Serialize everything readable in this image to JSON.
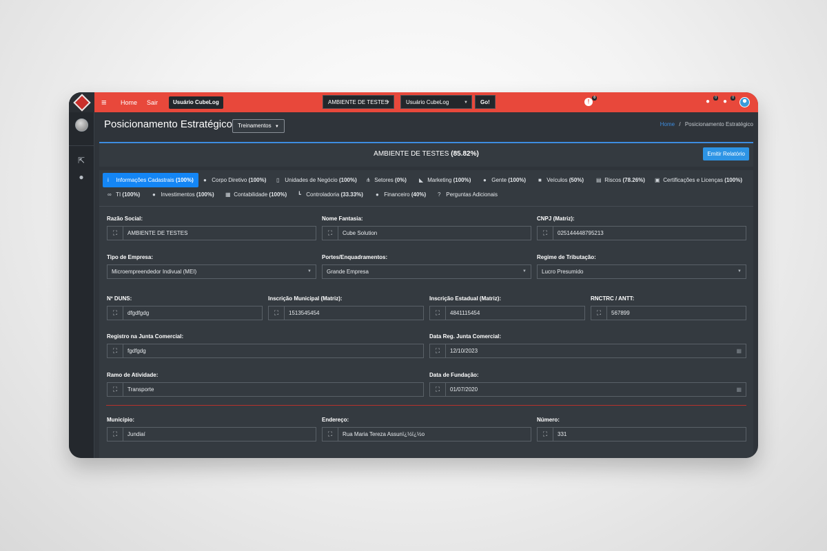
{
  "topbar": {
    "home": "Home",
    "sair": "Sair",
    "user_chip": "Usuário CubeLog",
    "env_select": "AMBIENTE DE TESTES",
    "user_select": "Usuário CubeLog",
    "go": "Go!",
    "notif_count": "0",
    "users_count_1": "0",
    "users_count_2": "0"
  },
  "page": {
    "title": "Posicionamento Estratégico",
    "treinamentos": "Treinamentos",
    "breadcrumb_home": "Home",
    "breadcrumb_sep": "/",
    "breadcrumb_current": "Posicionamento Estratégico"
  },
  "env": {
    "title_prefix": "AMBIENTE DE TESTES",
    "percent": "(85.82%)",
    "emitir": "Emitir Relatório"
  },
  "tabs": [
    {
      "label": "Informações Cadastrais",
      "pct": "(100%)",
      "icon": "info-icon",
      "glyph": "i"
    },
    {
      "label": "Corpo Diretivo",
      "pct": "(100%)",
      "icon": "user-icon",
      "glyph": "●"
    },
    {
      "label": "Unidades de Negócio",
      "pct": "(100%)",
      "icon": "building-icon",
      "glyph": "▯"
    },
    {
      "label": "Setores",
      "pct": "(0%)",
      "icon": "sitemap-icon",
      "glyph": "⋔"
    },
    {
      "label": "Marketing",
      "pct": "(100%)",
      "icon": "bullhorn-icon",
      "glyph": "◣"
    },
    {
      "label": "Gente",
      "pct": "(100%)",
      "icon": "users-icon",
      "glyph": "●"
    },
    {
      "label": "Veículos",
      "pct": "(50%)",
      "icon": "truck-icon",
      "glyph": "■"
    },
    {
      "label": "Riscos",
      "pct": "(78.26%)",
      "icon": "clipboard-icon",
      "glyph": "▤"
    },
    {
      "label": "Certificações e Licenças",
      "pct": "(100%)",
      "icon": "certificate-icon",
      "glyph": "▣"
    },
    {
      "label": "TI",
      "pct": "(100%)",
      "icon": "glasses-icon",
      "glyph": "∞"
    },
    {
      "label": "Investimentos",
      "pct": "(100%)",
      "icon": "coins-icon",
      "glyph": "●"
    },
    {
      "label": "Contabilidade",
      "pct": "(100%)",
      "icon": "calculator-icon",
      "glyph": "▦"
    },
    {
      "label": "Controladoria",
      "pct": "(33.33%)",
      "icon": "chart-icon",
      "glyph": "┗"
    },
    {
      "label": "Financeiro",
      "pct": "(40%)",
      "icon": "money-icon",
      "glyph": "●"
    },
    {
      "label": "Perguntas Adicionais",
      "pct": "",
      "icon": "question-icon",
      "glyph": "?"
    }
  ],
  "form": {
    "razao_social": {
      "label": "Razão Social:",
      "value": "AMBIENTE DE TESTES"
    },
    "nome_fantasia": {
      "label": "Nome Fantasia:",
      "value": "Cube Solution"
    },
    "cnpj": {
      "label": "CNPJ (Matriz):",
      "value": "025144448795213"
    },
    "tipo_empresa": {
      "label": "Tipo de Empresa:",
      "value": "Microempreendedor Indivual (MEI)"
    },
    "portes": {
      "label": "Portes/Enquadramentos:",
      "value": "Grande Empresa"
    },
    "regime": {
      "label": "Regime de Tributação:",
      "value": "Lucro Presumido"
    },
    "duns": {
      "label": "Nº DUNS:",
      "value": "dfgdfgdg"
    },
    "insc_municipal": {
      "label": "Inscrição Municipal (Matriz):",
      "value": "1513545454"
    },
    "insc_estadual": {
      "label": "Inscrição Estadual (Matriz):",
      "value": "4841115454"
    },
    "rntrc": {
      "label": "RNCTRC / ANTT:",
      "value": "567899"
    },
    "junta": {
      "label": "Registro na Junta Comercial:",
      "value": "fgdfgdg"
    },
    "data_junta": {
      "label": "Data Reg. Junta Comercial:",
      "value": "12/10/2023"
    },
    "ramo": {
      "label": "Ramo de Atividade:",
      "value": "Transporte"
    },
    "fundacao": {
      "label": "Data de Fundação:",
      "value": "01/07/2020"
    },
    "municipio": {
      "label": "Município:",
      "value": "Jundiaí"
    },
    "endereco": {
      "label": "Endereço:",
      "value": "Rua Maria Tereza Assunï¿½ï¿½o"
    },
    "numero": {
      "label": "Número:",
      "value": "331"
    }
  },
  "colors": {
    "topbar": "#e8483b",
    "accent": "#1486f5",
    "panel": "#343a40",
    "divider": "#b8322c"
  }
}
